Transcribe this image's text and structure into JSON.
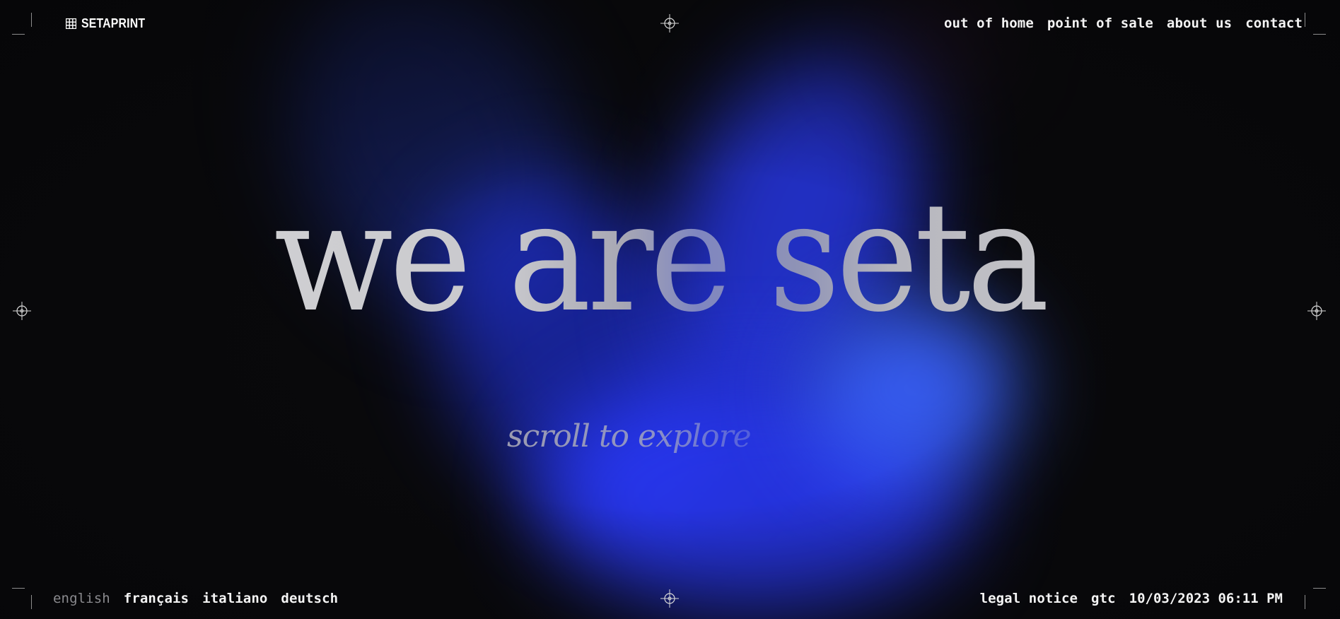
{
  "brand": {
    "name": "SETAPRINT",
    "icon": "grid-icon"
  },
  "nav": {
    "items": [
      {
        "label": "out of home"
      },
      {
        "label": "point of sale"
      },
      {
        "label": "about us"
      },
      {
        "label": "contact"
      }
    ]
  },
  "hero": {
    "title": "we are seta",
    "scroll_hint": "scroll to explore"
  },
  "languages": {
    "items": [
      {
        "label": "english",
        "active": true
      },
      {
        "label": "français",
        "active": false
      },
      {
        "label": "italiano",
        "active": false
      },
      {
        "label": "deutsch",
        "active": false
      }
    ]
  },
  "footer": {
    "legal_notice": "legal notice",
    "gtc": "gtc",
    "datetime": "10/03/2023 06:11 PM"
  },
  "colors": {
    "background": "#09090b",
    "accent_blue": "#2a3cff",
    "text": "#f4f4f4",
    "muted": "#8a8a8e"
  }
}
